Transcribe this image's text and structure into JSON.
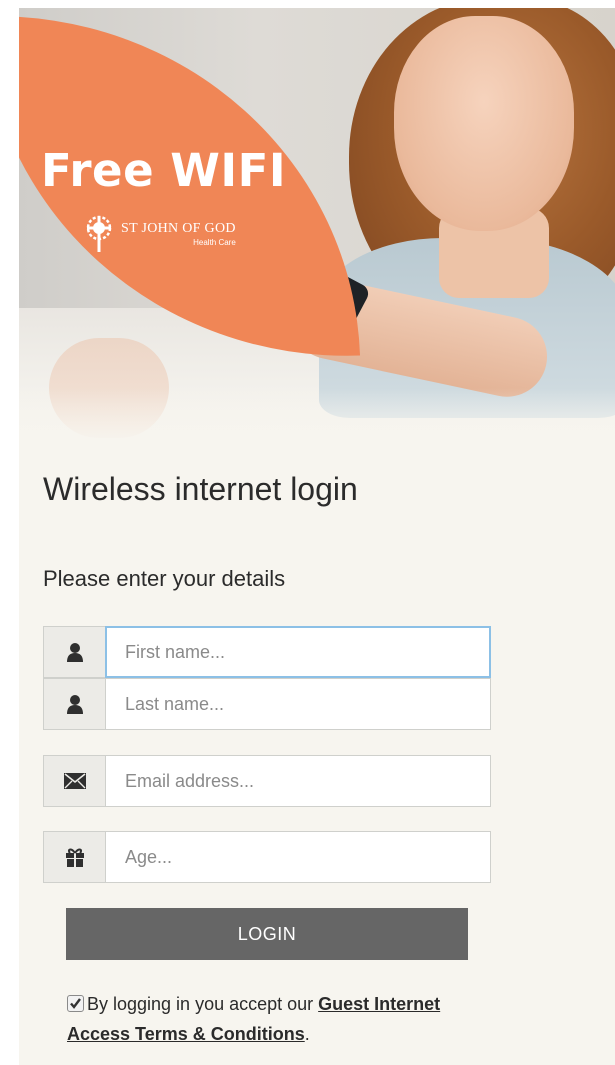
{
  "hero": {
    "headline": "Free WIFI",
    "logo_name": "ST JOHN OF GOD",
    "logo_subtitle": "Health Care"
  },
  "form": {
    "title": "Wireless internet login",
    "subtitle": "Please enter your details",
    "fields": [
      {
        "icon": "user-icon",
        "placeholder": "First name...",
        "value": "",
        "focused": true
      },
      {
        "icon": "user-icon",
        "placeholder": "Last name...",
        "value": ""
      },
      {
        "icon": "envelope-icon",
        "placeholder": "Email address...",
        "value": ""
      },
      {
        "icon": "gift-icon",
        "placeholder": "Age...",
        "value": ""
      }
    ],
    "login_label": "LOGIN",
    "terms": {
      "checked": true,
      "prefix": "By logging in you accept our",
      "link": "Guest Internet Access Terms & Conditions",
      "suffix": "."
    }
  },
  "colors": {
    "accent_orange": "#f08656",
    "button_gray": "#666666",
    "background": "#f7f5ef",
    "focus_border": "#8cc0e6"
  }
}
